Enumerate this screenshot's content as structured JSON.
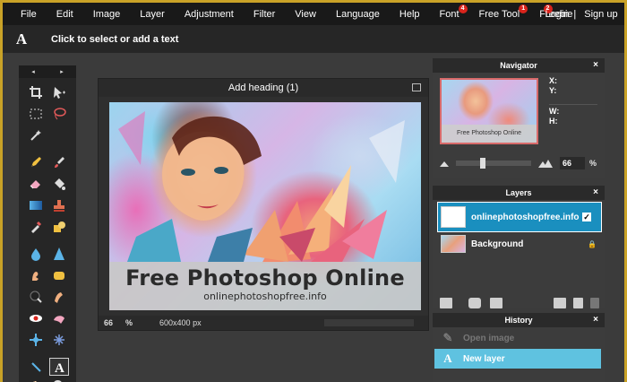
{
  "menu": {
    "items": [
      "File",
      "Edit",
      "Image",
      "Layer",
      "Adjustment",
      "Filter",
      "View",
      "Language",
      "Help"
    ],
    "font_label": "Font",
    "font_badge": "4",
    "freetool_label": "Free Tool",
    "freetool_badge": "1",
    "freebie_label": "Freebie",
    "freebie_badge": "2",
    "login_label": "Login",
    "separator": "|",
    "signup_label": "Sign up"
  },
  "options": {
    "tool_glyph": "A",
    "hint": "Click to select or add a text"
  },
  "toolbox": {
    "collapse_left": "◂",
    "collapse_right": "▸",
    "active_tool": "text-tool"
  },
  "document": {
    "title": "Add heading (1)",
    "banner_title": "Free Photoshop Online",
    "banner_subtitle": "onlinephotoshopfree.info",
    "zoom": "66",
    "zoom_unit": "%",
    "size": "600x400 px"
  },
  "navigator": {
    "title": "Navigator",
    "close": "×",
    "thumb_caption": "Free Photoshop Online",
    "x_label": "X:",
    "y_label": "Y:",
    "w_label": "W:",
    "h_label": "H:",
    "zoom_value": "66",
    "zoom_unit": "%",
    "zoom_level": 0.35
  },
  "layers": {
    "title": "Layers",
    "close": "×",
    "items": [
      {
        "name": "onlinephotoshopfree.info",
        "selected": true,
        "visible_check": "✓"
      },
      {
        "name": "Background",
        "selected": false,
        "lock": "🔒"
      }
    ]
  },
  "history": {
    "title": "History",
    "close": "×",
    "items": [
      {
        "name": "Open image",
        "icon": "✎",
        "selected": false
      },
      {
        "name": "New layer",
        "icon": "A",
        "selected": true
      }
    ]
  },
  "colors": {
    "frame": "#c9a227",
    "accent_blue": "#1a8fbf",
    "history_selected": "#5fc2e0",
    "badge_red": "#d9241c"
  }
}
